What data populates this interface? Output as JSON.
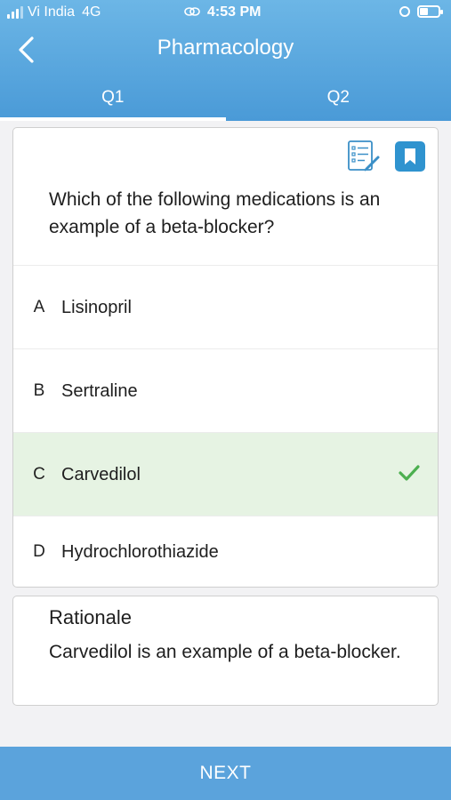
{
  "status_bar": {
    "carrier": "Vi India",
    "network": "4G",
    "time": "4:53 PM"
  },
  "header": {
    "title": "Pharmacology",
    "back_icon": "chevron-left-icon"
  },
  "tabs": [
    {
      "label": "Q1",
      "active": true
    },
    {
      "label": "Q2",
      "active": false
    }
  ],
  "question": {
    "text": "Which of the following medications is an example of a beta-blocker?",
    "tools": [
      "notes-checklist-icon",
      "bookmark-icon"
    ],
    "options": [
      {
        "letter": "A",
        "text": "Lisinopril",
        "correct": false
      },
      {
        "letter": "B",
        "text": "Sertraline",
        "correct": false
      },
      {
        "letter": "C",
        "text": "Carvedilol",
        "correct": true
      },
      {
        "letter": "D",
        "text": "Hydrochlorothiazide",
        "correct": false
      }
    ]
  },
  "rationale": {
    "title": "Rationale",
    "text": "Carvedilol is an example of a beta-blocker."
  },
  "footer": {
    "next_label": "NEXT"
  },
  "colors": {
    "header": "#5aa8df",
    "correct_bg": "#e6f3e3",
    "check": "#4caf50",
    "bookmark": "#2f93cf"
  }
}
